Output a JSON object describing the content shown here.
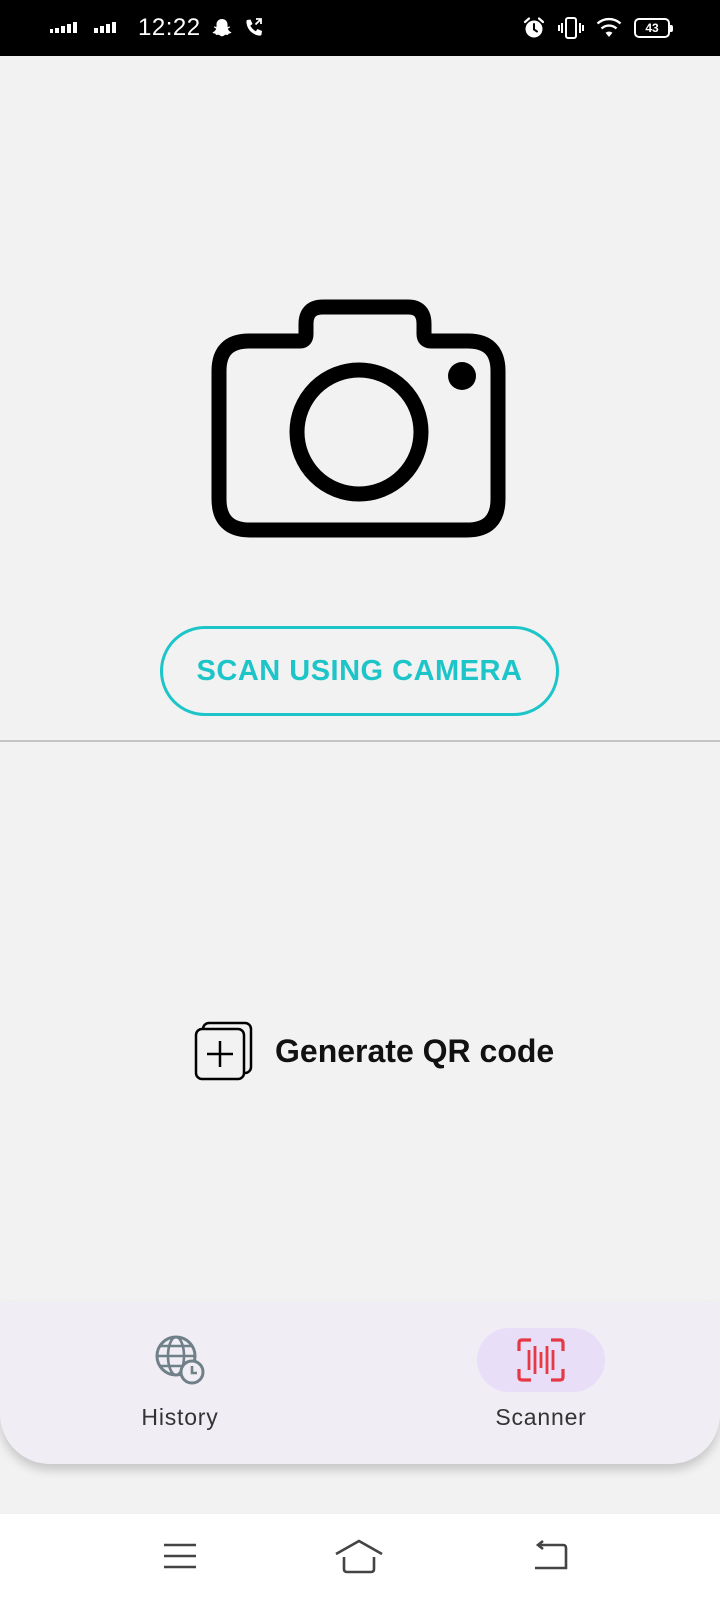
{
  "status_bar": {
    "time": "12:22",
    "battery": "43"
  },
  "scan": {
    "button_label": "SCAN USING CAMERA"
  },
  "generate": {
    "label": "Generate QR code"
  },
  "bottom_nav": {
    "items": [
      {
        "label": "History",
        "icon": "globe-clock-icon",
        "selected": false
      },
      {
        "label": "Scanner",
        "icon": "barcode-scan-icon",
        "selected": true
      }
    ]
  },
  "colors": {
    "accent": "#1dc5c8",
    "scanner_icon": "#e53945",
    "nav_background": "#f1edf4",
    "nav_selected_pill": "#e8def8"
  }
}
